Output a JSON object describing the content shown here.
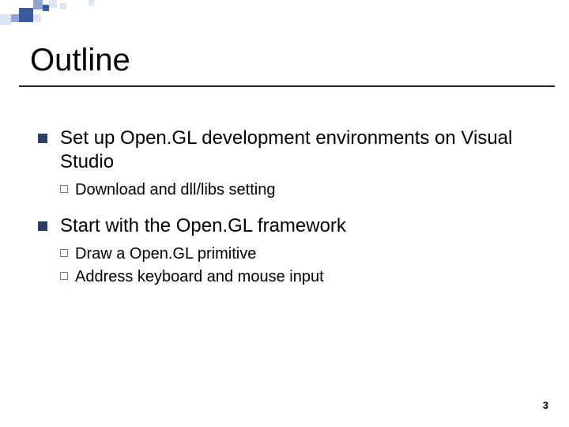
{
  "slide": {
    "title": "Outline",
    "bullets": [
      {
        "text": "Set up Open.GL development environments on Visual Studio",
        "sub": [
          {
            "text": "Download and dll/libs setting"
          }
        ]
      },
      {
        "text": "Start with the Open.GL framework",
        "sub": [
          {
            "text": "Draw a Open.GL primitive"
          },
          {
            "text": "Address keyboard and mouse input"
          }
        ]
      }
    ],
    "page_number": "3"
  }
}
